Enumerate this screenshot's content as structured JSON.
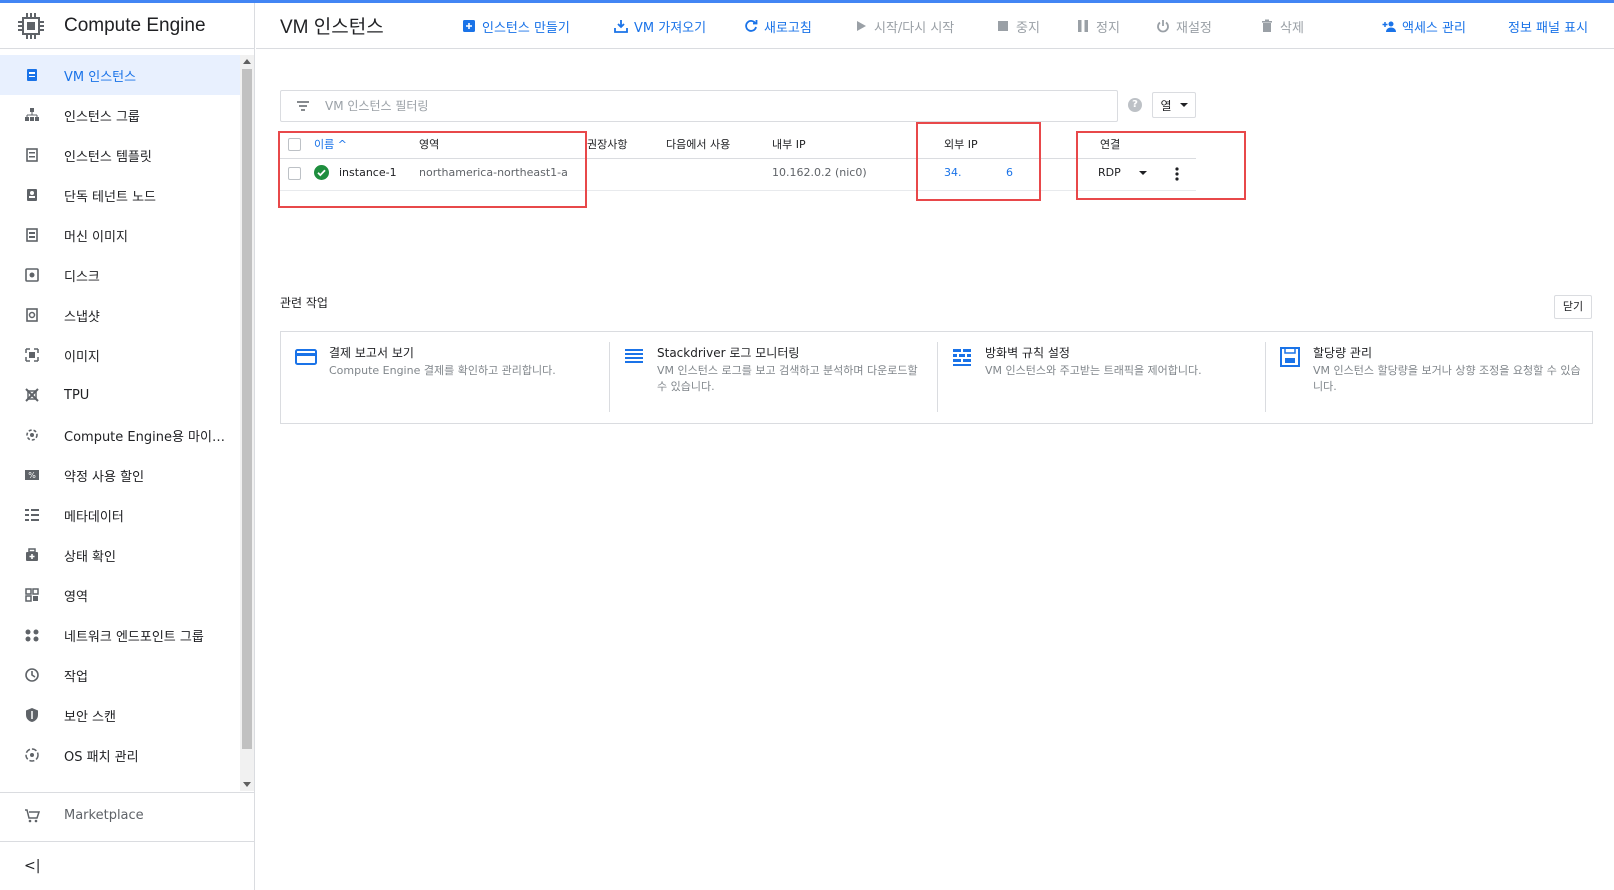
{
  "app": {
    "title": "Compute Engine"
  },
  "sidebar": {
    "items": [
      {
        "label": "VM 인스턴스",
        "icon": "vm-instances-icon"
      },
      {
        "label": "인스턴스 그룹",
        "icon": "instance-groups-icon"
      },
      {
        "label": "인스턴스 템플릿",
        "icon": "instance-templates-icon"
      },
      {
        "label": "단독 테넌트 노드",
        "icon": "sole-tenant-icon"
      },
      {
        "label": "머신 이미지",
        "icon": "machine-image-icon"
      },
      {
        "label": "디스크",
        "icon": "disk-icon"
      },
      {
        "label": "스냅샷",
        "icon": "snapshot-icon"
      },
      {
        "label": "이미지",
        "icon": "image-icon"
      },
      {
        "label": "TPU",
        "icon": "tpu-icon"
      },
      {
        "label": "Compute Engine용 마이…",
        "icon": "migrate-icon"
      },
      {
        "label": "약정 사용 할인",
        "icon": "discount-icon"
      },
      {
        "label": "메타데이터",
        "icon": "metadata-icon"
      },
      {
        "label": "상태 확인",
        "icon": "health-check-icon"
      },
      {
        "label": "영역",
        "icon": "zones-icon"
      },
      {
        "label": "네트워크 엔드포인트 그룹",
        "icon": "network-endpoint-icon"
      },
      {
        "label": "작업",
        "icon": "operations-icon"
      },
      {
        "label": "보안 스캔",
        "icon": "security-scan-icon"
      },
      {
        "label": "OS 패치 관리",
        "icon": "os-patch-icon"
      }
    ],
    "marketplace": "Marketplace",
    "collapse": "<|"
  },
  "header": {
    "title": "VM 인스턴스",
    "actions": {
      "create": "인스턴스 만들기",
      "import": "VM 가져오기",
      "refresh": "새로고침",
      "start": "시작/다시 시작",
      "stop": "중지",
      "suspend": "정지",
      "reset": "재설정",
      "delete": "삭제",
      "access": "액세스 관리",
      "info_panel": "정보 패널 표시"
    }
  },
  "filter": {
    "placeholder": "VM 인스턴스 필터링",
    "columns_label": "열",
    "help": "?"
  },
  "table": {
    "headers": {
      "name": "이름 ^",
      "zone": "영역",
      "recommendation": "권장사항",
      "in_use_by": "다음에서 사용",
      "internal_ip": "내부 IP",
      "external_ip": "외부 IP",
      "connect": "연결"
    },
    "rows": [
      {
        "status": "running",
        "name": "instance-1",
        "zone": "northamerica-northeast1-a",
        "recommendation": "",
        "in_use_by": "",
        "internal_ip": "10.162.0.2 (nic0)",
        "external_ip_start": "34.",
        "external_ip_end": "6",
        "connect": "RDP"
      }
    ]
  },
  "related": {
    "title": "관련 작업",
    "close": "닫기",
    "cards": [
      {
        "title": "결제 보고서 보기",
        "desc": "Compute Engine 결제를 확인하고 관리합니다.",
        "icon": "billing-icon"
      },
      {
        "title": "Stackdriver 로그 모니터링",
        "desc": "VM 인스턴스 로그를 보고 검색하고 분석하며 다운로드할 수 있습니다.",
        "icon": "logs-icon"
      },
      {
        "title": "방화벽 규칙 설정",
        "desc": "VM 인스턴스와 주고받는 트래픽을 제어합니다.",
        "icon": "firewall-icon"
      },
      {
        "title": "할당량 관리",
        "desc": "VM 인스턴스 할당량을 보거나 상향 조정을 요청할 수 있습니다.",
        "icon": "quota-icon"
      }
    ]
  },
  "colors": {
    "accent": "#1a73e8",
    "status_ok": "#1e8e3e",
    "highlight": "#e8484a",
    "active_bg": "#e8f0fe"
  }
}
